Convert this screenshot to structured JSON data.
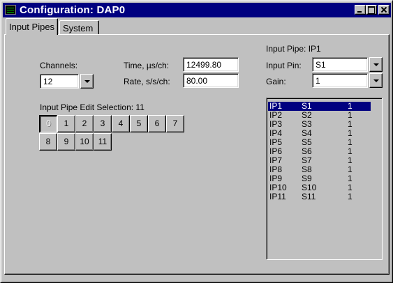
{
  "window": {
    "title": "Configuration:  DAP0",
    "icon": "app-icon"
  },
  "tabs": [
    {
      "label": "Input Pipes",
      "active": true
    },
    {
      "label": "System",
      "active": false
    }
  ],
  "channels": {
    "label": "Channels:",
    "value": "12"
  },
  "time": {
    "label": "Time, µs/ch:",
    "value": "12499.80"
  },
  "rate": {
    "label": "Rate, s/s/ch:",
    "value": "80.00"
  },
  "edit_selection": {
    "label": "Input Pipe Edit Selection:  11",
    "pins": [
      "0",
      "1",
      "2",
      "3",
      "4",
      "5",
      "6",
      "7",
      "8",
      "9",
      "10",
      "11"
    ],
    "selected_pin": "0"
  },
  "pipe_panel": {
    "header": "Input Pipe: IP1",
    "input_pin": {
      "label": "Input Pin:",
      "value": "S1"
    },
    "gain": {
      "label": "Gain:",
      "value": "1"
    }
  },
  "pipe_list": {
    "selected_index": 0,
    "rows": [
      {
        "pipe": "IP1",
        "pin": "S1",
        "gain": "1"
      },
      {
        "pipe": "IP2",
        "pin": "S2",
        "gain": "1"
      },
      {
        "pipe": "IP3",
        "pin": "S3",
        "gain": "1"
      },
      {
        "pipe": "IP4",
        "pin": "S4",
        "gain": "1"
      },
      {
        "pipe": "IP5",
        "pin": "S5",
        "gain": "1"
      },
      {
        "pipe": "IP6",
        "pin": "S6",
        "gain": "1"
      },
      {
        "pipe": "IP7",
        "pin": "S7",
        "gain": "1"
      },
      {
        "pipe": "IP8",
        "pin": "S8",
        "gain": "1"
      },
      {
        "pipe": "IP9",
        "pin": "S9",
        "gain": "1"
      },
      {
        "pipe": "IP10",
        "pin": "S10",
        "gain": "1"
      },
      {
        "pipe": "IP11",
        "pin": "S11",
        "gain": "1"
      }
    ]
  },
  "colors": {
    "face": "#c0c0c0",
    "titlebar": "#000080",
    "selection": "#000080"
  }
}
